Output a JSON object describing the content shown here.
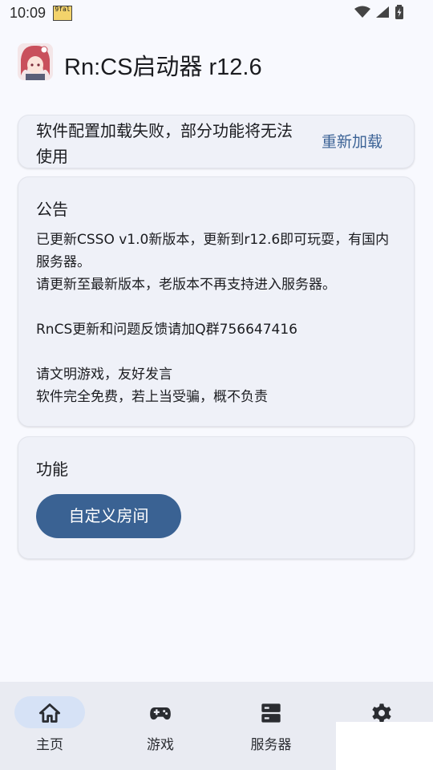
{
  "status_bar": {
    "time": "10:09",
    "app_icon_text": "9fal"
  },
  "header": {
    "title": "Rn:CS启动器 r12.6"
  },
  "error_card": {
    "message": "软件配置加载失败，部分功能将无法使用",
    "reload_label": "重新加载"
  },
  "notice_card": {
    "title": "公告",
    "lines": [
      "已更新CSSO v1.0新版本，更新到r12.6即可玩耍，有国内服务器。",
      "请更新至最新版本，老版本不再支持进入服务器。",
      "",
      "RnCS更新和问题反馈请加Q群756647416",
      "",
      "请文明游戏，友好发言",
      "软件完全免费，若上当受骗，概不负责"
    ]
  },
  "feature_card": {
    "title": "功能",
    "custom_room_label": "自定义房间"
  },
  "bottom_nav": {
    "items": [
      {
        "label": "主页",
        "icon": "home-icon",
        "active": true
      },
      {
        "label": "游戏",
        "icon": "gamepad-icon",
        "active": false
      },
      {
        "label": "服务器",
        "icon": "server-icon",
        "active": false
      },
      {
        "label": "",
        "icon": "settings-icon",
        "active": false
      }
    ]
  },
  "colors": {
    "background": "#f8f9fe",
    "card": "#eff1f8",
    "accent": "#3a6293",
    "link": "#3c6396",
    "nav_bg": "#e9ebf2",
    "nav_active_pill": "#d6e2f6"
  }
}
